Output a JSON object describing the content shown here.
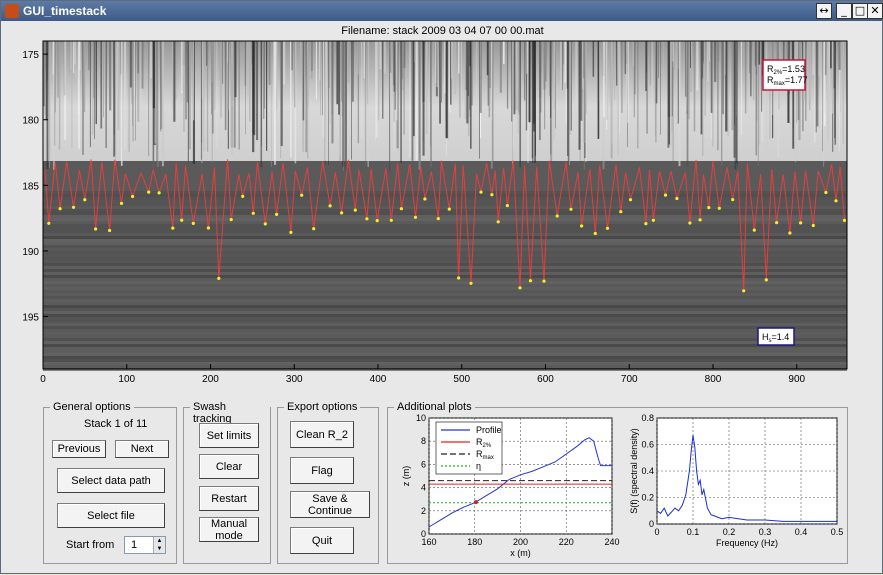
{
  "window": {
    "title": "GUI_timestack",
    "controls": {
      "resize": "↔",
      "minimize": "_",
      "maximize": "□",
      "close": "✕"
    }
  },
  "filename_label": "Filename: stack 2009 03 04 07 00 00.mat",
  "timestack": {
    "y_ticks": [
      "175",
      "180",
      "185",
      "190",
      "195"
    ],
    "x_ticks": [
      "0",
      "100",
      "200",
      "300",
      "400",
      "500",
      "600",
      "700",
      "800",
      "900"
    ],
    "annotations": {
      "r2_label": "R",
      "r2_sub": "2%",
      "r2_value": "=1.53",
      "rmax_label": "R",
      "rmax_sub": "max",
      "rmax_value": "=1.77",
      "hs_label": "H",
      "hs_sub": "s",
      "hs_value": "=1.4"
    },
    "colors": {
      "background": "#5a5a5a",
      "swash_line": "#ff3a3a",
      "runup_points": "#f5ee2a",
      "annotation_border": "#c8143c",
      "hs_border": "#1a1a7a"
    }
  },
  "general_options": {
    "title": "General options",
    "stack_counter": "Stack 1 of 11",
    "previous": "Previous",
    "next": "Next",
    "select_data_path": "Select data path",
    "select_file": "Select file",
    "start_from_label": "Start from",
    "start_from_value": "1"
  },
  "swash_tracking": {
    "title": "Swash tracking",
    "set_limits": "Set limits",
    "clear": "Clear",
    "restart": "Restart",
    "manual_mode": "Manual mode"
  },
  "export_options": {
    "title": "Export options",
    "clean_r2": "Clean R_2",
    "flag": "Flag",
    "save_continue": "Save & Continue",
    "quit": "Quit"
  },
  "additional_plots": {
    "title": "Additional plots",
    "profile_plot": {
      "ylabel": "z (m)",
      "xlabel": "x (m)",
      "y_ticks": [
        "0",
        "2",
        "4",
        "6",
        "8",
        "10"
      ],
      "x_ticks": [
        "160",
        "180",
        "200",
        "220",
        "240"
      ],
      "legend": [
        {
          "label": "Profile",
          "sub": "",
          "color": "#2233dd",
          "dash": ""
        },
        {
          "label": "R",
          "sub": "2%",
          "color": "#e82020",
          "dash": ""
        },
        {
          "label": "R",
          "sub": "max",
          "color": "#222222",
          "dash": "6,3"
        },
        {
          "label": "η",
          "sub": "",
          "color": "#22aa22",
          "dash": "2,2"
        }
      ]
    },
    "spectrum_plot": {
      "ylabel": "S(f) (spectral density)",
      "xlabel": "Frequency (Hz)",
      "y_ticks": [
        "0",
        "0.2",
        "0.4",
        "0.6",
        "0.8"
      ],
      "x_ticks": [
        "0",
        "0.1",
        "0.2",
        "0.3",
        "0.4",
        "0.5"
      ]
    }
  },
  "chart_data": [
    {
      "type": "line",
      "title": "",
      "xlabel": "x (m)",
      "ylabel": "z (m)",
      "xlim": [
        160,
        240
      ],
      "ylim": [
        0,
        10
      ],
      "series": [
        {
          "name": "Profile",
          "x": [
            160,
            165,
            170,
            175,
            180,
            185,
            190,
            195,
            200,
            205,
            210,
            215,
            220,
            225,
            228,
            230,
            232,
            234,
            235,
            236,
            240
          ],
          "y": [
            0.6,
            1.2,
            1.8,
            2.3,
            2.7,
            3.3,
            3.9,
            4.7,
            5.1,
            5.4,
            5.8,
            6.2,
            6.9,
            7.6,
            8.1,
            8.3,
            8.0,
            6.5,
            5.9,
            5.9,
            5.9
          ]
        },
        {
          "name": "R2%",
          "x": [
            160,
            240
          ],
          "y": [
            4.3,
            4.3
          ]
        },
        {
          "name": "Rmax",
          "x": [
            160,
            240
          ],
          "y": [
            4.6,
            4.6
          ]
        },
        {
          "name": "η",
          "x": [
            160,
            240
          ],
          "y": [
            2.7,
            2.7
          ]
        }
      ]
    },
    {
      "type": "line",
      "title": "",
      "xlabel": "Frequency (Hz)",
      "ylabel": "S(f) (spectral density)",
      "xlim": [
        0,
        0.5
      ],
      "ylim": [
        0,
        0.8
      ],
      "series": [
        {
          "x": [
            0,
            0.01,
            0.02,
            0.03,
            0.04,
            0.05,
            0.06,
            0.07,
            0.08,
            0.09,
            0.095,
            0.1,
            0.105,
            0.11,
            0.115,
            0.12,
            0.125,
            0.13,
            0.14,
            0.15,
            0.16,
            0.18,
            0.2,
            0.25,
            0.3,
            0.35,
            0.4,
            0.45,
            0.5
          ],
          "y": [
            0.1,
            0.08,
            0.12,
            0.06,
            0.09,
            0.12,
            0.1,
            0.14,
            0.22,
            0.4,
            0.55,
            0.67,
            0.58,
            0.4,
            0.3,
            0.33,
            0.22,
            0.26,
            0.12,
            0.07,
            0.06,
            0.04,
            0.05,
            0.03,
            0.03,
            0.02,
            0.02,
            0.02,
            0.02
          ]
        }
      ]
    }
  ]
}
